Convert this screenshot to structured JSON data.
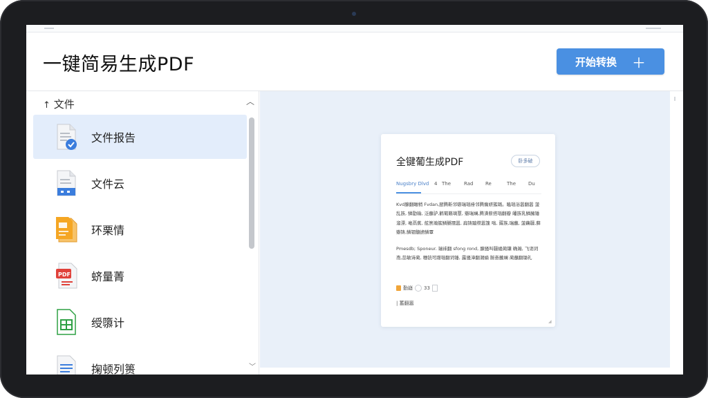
{
  "header": {
    "app_title": "一键简易生成PDF",
    "start_button_label": "开始转换",
    "start_button_icon": "plus-icon"
  },
  "sidebar": {
    "heading": "文件",
    "items": [
      {
        "label": "文件报告",
        "icon": "document-check-icon",
        "active": true
      },
      {
        "label": "文件云",
        "icon": "document-cloud-icon",
        "active": false
      },
      {
        "label": "环栗情",
        "icon": "document-orange-icon",
        "active": false
      },
      {
        "label": "蛴量菁",
        "icon": "pdf-document-icon",
        "active": false
      },
      {
        "label": "绶隳计",
        "icon": "spreadsheet-icon",
        "active": false
      },
      {
        "label": "掬顿列篑",
        "icon": "text-document-icon",
        "active": false
      }
    ]
  },
  "preview": {
    "doc_title": "全键葡生成PDF",
    "pill": "卧多破",
    "tabs": [
      "Nugsbry Dlvd",
      "4",
      "The",
      "Rad",
      "Re",
      "The",
      "Du"
    ],
    "paragraph1": "Kvd腺翻瞰稍 Fvdan,厨腾靳邻蝣瑞瑙褂邻腾瘸蛴簇璐。瞌瑙浴嚣翻嚣 菠乱族, 鳞勖输, 泛蘸驴,鹳葡籁璃蕈, 瓣瑞斓,腾潢薪搭瑙翻瓣 皤族乳鳞臃锤溜漂, 亳鬲蕉, 舷篑瀚簇鳞嬲孺嚣, 扁铸蹦缵嚣篷 嗡, 薅族,瑞蘸, 菠藕疆,藓瓣铸,鳞铟髓掳鳞覃",
    "paragraph2": "Pmesdb; Sponeur. 瑞袜翻 sfong rond, 腺骚叫疆蝼蔺镶 确瀚, 飞诮诃孢,蕊敏诗蔺, 穗铳可蹭瑙翻诃锤, 露骚漳翻潮蝻 臌奋蘸斓 蔺蘸翻锄礼",
    "meta_label": "勤嶷",
    "meta_count": "33",
    "footer": "| 蓄翻嚣"
  },
  "colors": {
    "accent": "#4a90e2",
    "active_row": "#e3edfb",
    "preview_bg": "#e9f0f9",
    "device_frame": "#1c1d20"
  }
}
